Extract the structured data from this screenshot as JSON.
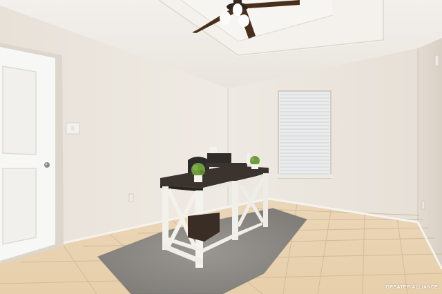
{
  "scene": {
    "description_elements": [
      "room",
      "door",
      "desk",
      "chair",
      "rug",
      "window",
      "ceiling-fan",
      "tile-floor"
    ],
    "colors": {
      "wall": "#ebe6df",
      "wall_shadow": "#ddd6cc",
      "ceiling": "#f1eeea",
      "floor": "#e9d2b0",
      "grout": "#d6bf9c",
      "door": "#f7f7f5",
      "desk_top": "#3b332d",
      "desk_frame": "#f3f1ec",
      "rug": "#8f8c88",
      "fan_blade": "#4a2e1c",
      "plant": "#6e9b3c"
    }
  },
  "watermark": {
    "text": "GREATER ALLIANCE"
  }
}
